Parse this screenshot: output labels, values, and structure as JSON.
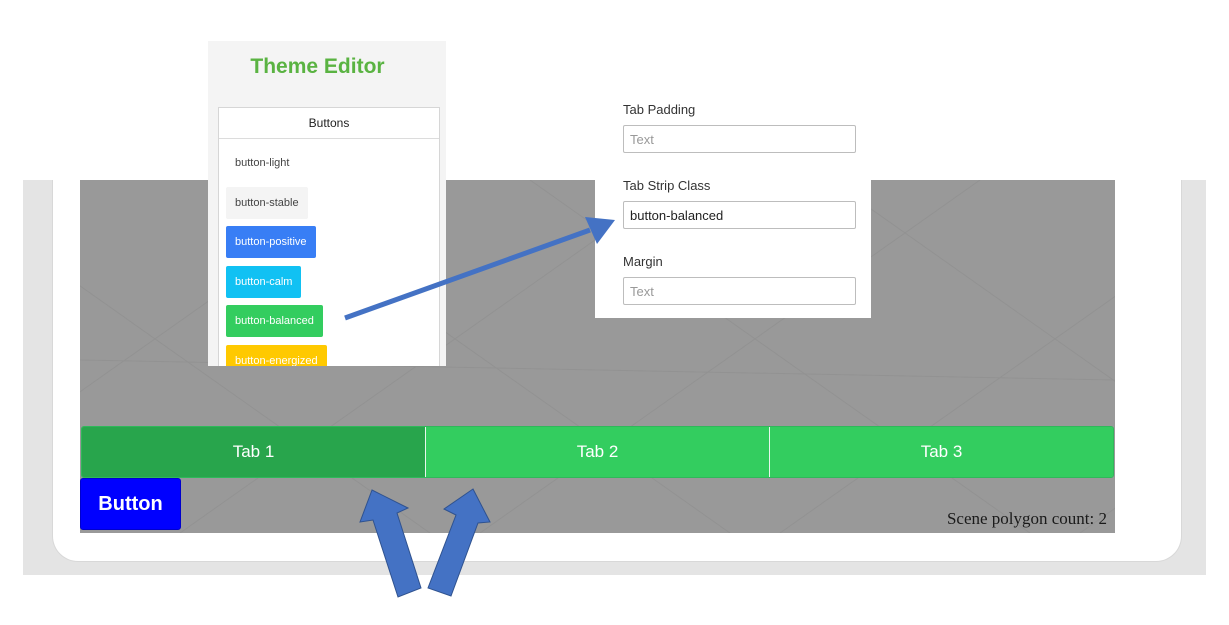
{
  "theme_editor": {
    "title": "Theme Editor",
    "section_header": "Buttons",
    "samples": [
      {
        "label": "button-light"
      },
      {
        "label": "button-stable"
      },
      {
        "label": "button-positive"
      },
      {
        "label": "button-calm"
      },
      {
        "label": "button-balanced"
      },
      {
        "label": "button-energized"
      }
    ]
  },
  "properties": {
    "tab_padding": {
      "label": "Tab Padding",
      "placeholder": "Text",
      "value": ""
    },
    "tab_strip_class": {
      "label": "Tab Strip Class",
      "placeholder": "Text",
      "value": "button-balanced"
    },
    "margin": {
      "label": "Margin",
      "placeholder": "Text",
      "value": ""
    }
  },
  "scene": {
    "tabs": [
      {
        "label": "Tab 1"
      },
      {
        "label": "Tab 2"
      },
      {
        "label": "Tab 3"
      }
    ],
    "button_label": "Button",
    "polygon_count_text": "Scene polygon count: 2"
  },
  "colors": {
    "balanced": "#33cd5f",
    "balanced_active": "#28a54c",
    "positive": "#387ef5",
    "calm": "#11c1f3",
    "energized": "#ffc900",
    "annotation_arrow": "#4472c4",
    "blue_button": "#0000ff",
    "title_green": "#5ab342"
  }
}
